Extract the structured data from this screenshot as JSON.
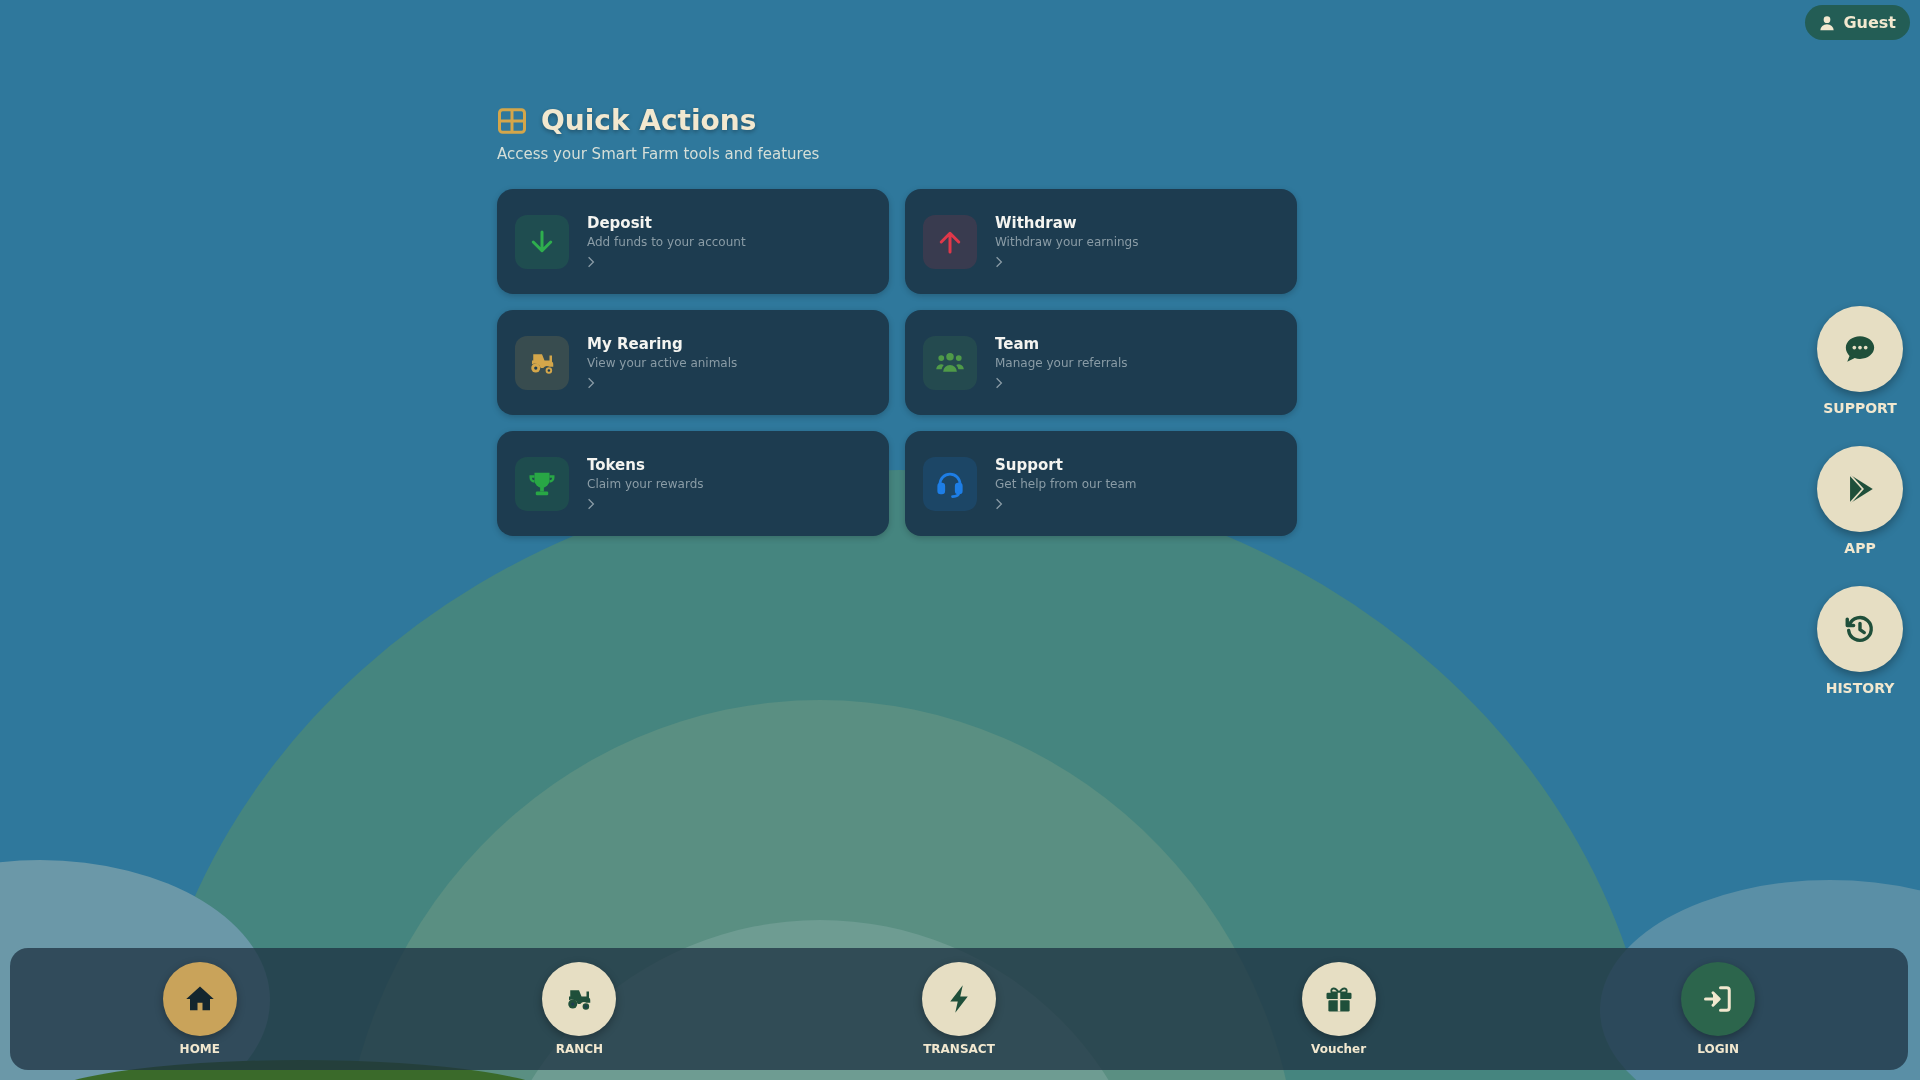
{
  "user_badge": {
    "label": "Guest"
  },
  "section": {
    "title": "Quick Actions",
    "subtitle": "Access your Smart Farm tools and features"
  },
  "actions": [
    {
      "kind": "deposit",
      "title": "Deposit",
      "description": "Add funds to your account",
      "color": "#2fae4e"
    },
    {
      "kind": "withdraw",
      "title": "Withdraw",
      "description": "Withdraw your earnings",
      "color": "#e0384a"
    },
    {
      "kind": "rearing",
      "title": "My Rearing",
      "description": "View your active animals",
      "color": "#d4a64a"
    },
    {
      "kind": "team",
      "title": "Team",
      "description": "Manage your referrals",
      "color": "#4f9a48"
    },
    {
      "kind": "tokens",
      "title": "Tokens",
      "description": "Claim your rewards",
      "color": "#28a745"
    },
    {
      "kind": "support",
      "title": "Support",
      "description": "Get help from our team",
      "color": "#1e7ee6"
    }
  ],
  "side_buttons": [
    {
      "kind": "chat",
      "label": "SUPPORT"
    },
    {
      "kind": "play",
      "label": "APP"
    },
    {
      "kind": "history",
      "label": "HISTORY"
    }
  ],
  "bottom_nav": [
    {
      "kind": "home",
      "label": "HOME",
      "selected": true
    },
    {
      "kind": "tractor",
      "label": "RANCH",
      "selected": false
    },
    {
      "kind": "bolt",
      "label": "TRANSACT",
      "selected": false
    },
    {
      "kind": "gift",
      "label": "Voucher",
      "selected": false
    },
    {
      "kind": "login",
      "label": "LOGIN",
      "selected": false
    }
  ]
}
